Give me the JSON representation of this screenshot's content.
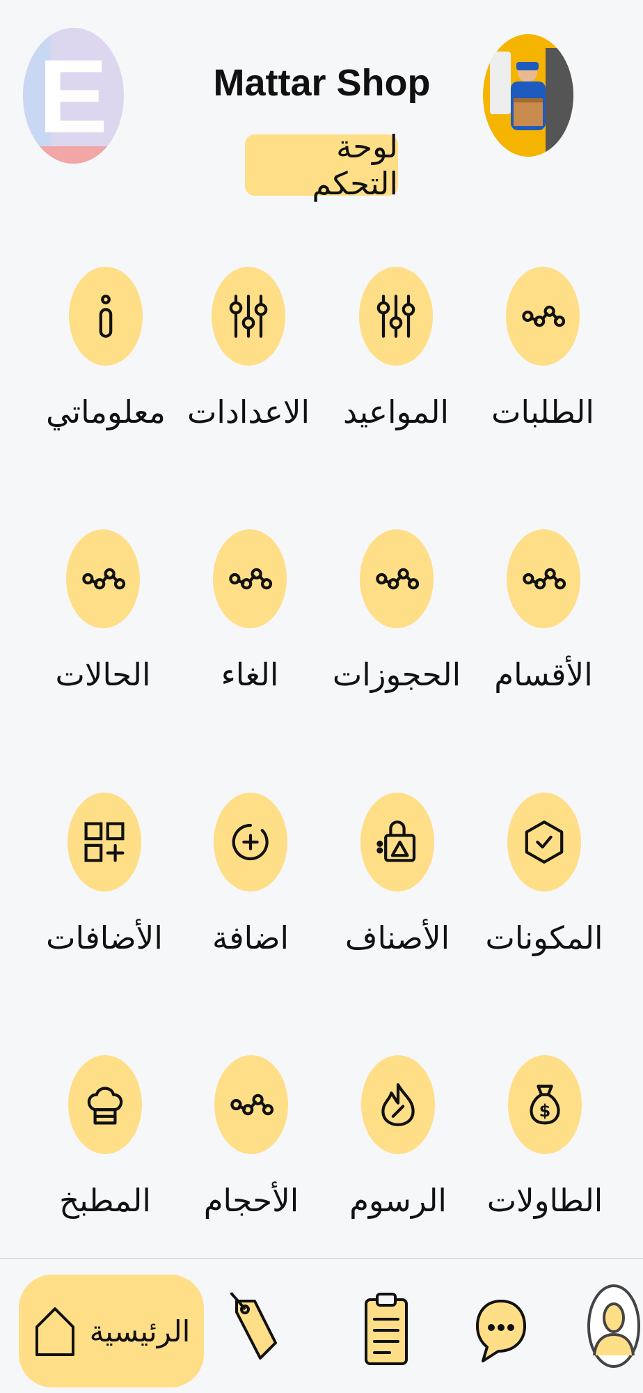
{
  "header": {
    "shop_name": "Mattar Shop",
    "dashboard_label": "لوحة التحكم",
    "logo_letter": "E"
  },
  "grid": [
    [
      {
        "label": "الطلبات",
        "icon": "nodes-icon"
      },
      {
        "label": "المواعيد",
        "icon": "sliders-icon"
      },
      {
        "label": "الاعدادات",
        "icon": "sliders-icon"
      },
      {
        "label": "معلوماتي",
        "icon": "info-icon"
      }
    ],
    [
      {
        "label": "الأقسام",
        "icon": "nodes-icon"
      },
      {
        "label": "الحجوزات",
        "icon": "nodes-icon"
      },
      {
        "label": "الغاء",
        "icon": "nodes-icon"
      },
      {
        "label": "الحالات",
        "icon": "nodes-icon"
      }
    ],
    [
      {
        "label": "المكونات",
        "icon": "hexagon-icon"
      },
      {
        "label": "الأصناف",
        "icon": "shopping-bag-icon"
      },
      {
        "label": "اضافة",
        "icon": "add-circle-icon"
      },
      {
        "label": "الأضافات",
        "icon": "add-grid-icon"
      }
    ],
    [
      {
        "label": "الطاولات",
        "icon": "money-bag-icon"
      },
      {
        "label": "الرسوم",
        "icon": "flame-icon"
      },
      {
        "label": "الأحجام",
        "icon": "nodes-icon"
      },
      {
        "label": "المطبخ",
        "icon": "chef-hat-icon"
      }
    ]
  ],
  "bottom_nav": {
    "home_label": "الرئيسية",
    "items": [
      "home-icon",
      "tag-icon",
      "clipboard-icon",
      "chat-icon",
      "profile-icon"
    ]
  },
  "colors": {
    "accent": "#ffde88",
    "background": "#f6f7f9",
    "text": "#111111"
  }
}
